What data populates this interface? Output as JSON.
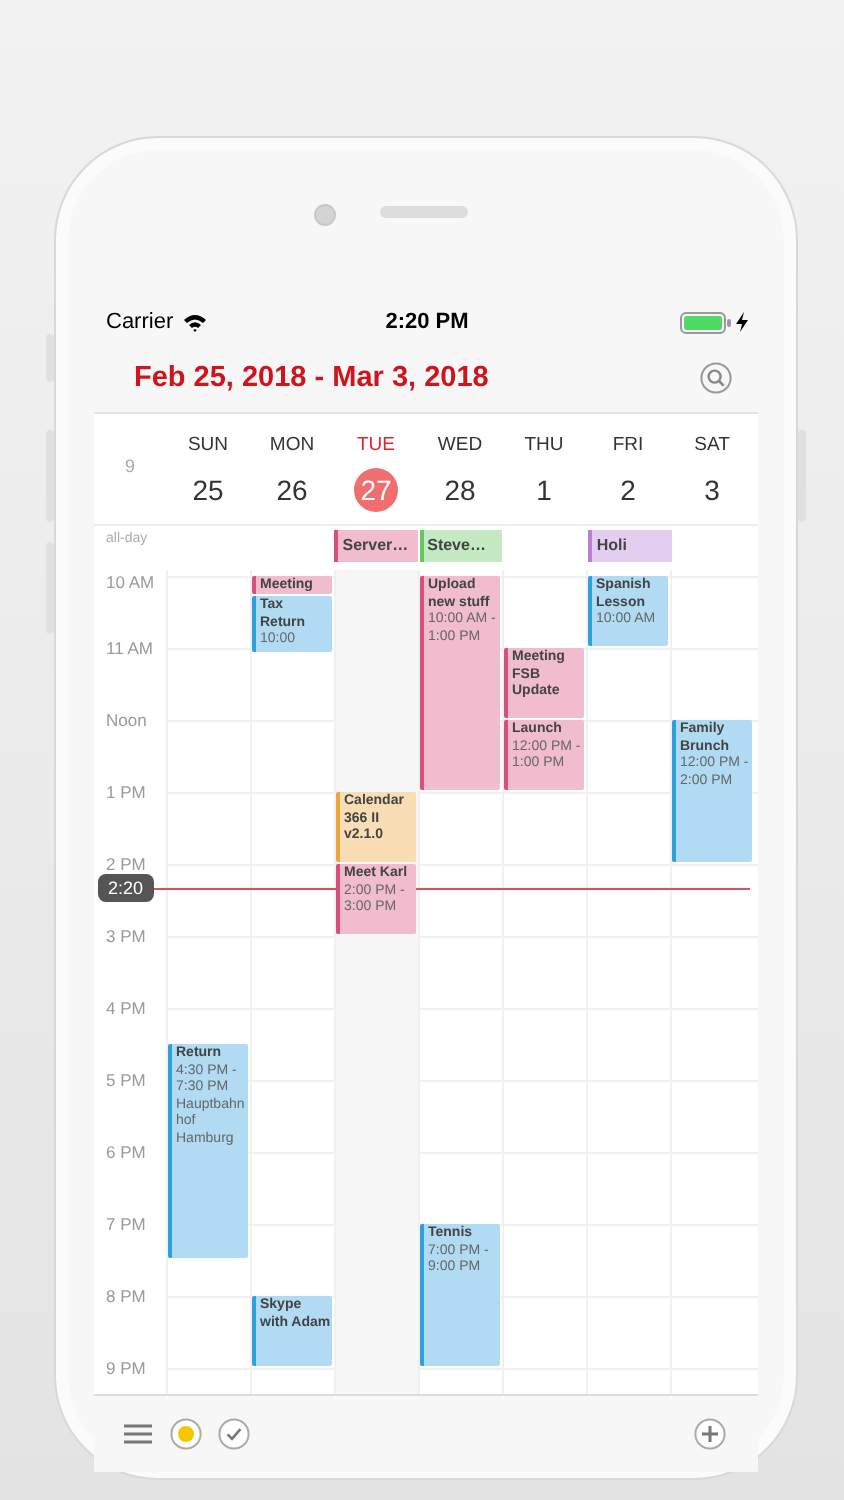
{
  "status_bar": {
    "carrier": "Carrier",
    "time": "2:20 PM"
  },
  "header": {
    "title": "Feb 25, 2018 - Mar 3, 2018"
  },
  "week_number": "9",
  "all_day_label": "all-day",
  "hours": [
    "10 AM",
    "11 AM",
    "Noon",
    "1 PM",
    "2 PM",
    "3 PM",
    "4 PM",
    "5 PM",
    "6 PM",
    "7 PM",
    "8 PM",
    "9 PM"
  ],
  "days": [
    {
      "weekday": "SUN",
      "date": "25",
      "today": false,
      "events": [
        {
          "title": "Return",
          "time": "4:30 PM - 7:30 PM",
          "note": "Hauptbahnhof Hamburg",
          "color": "#2ea1dc"
        }
      ]
    },
    {
      "weekday": "MON",
      "date": "26",
      "today": false,
      "events": [
        {
          "title": "Meeting",
          "color": "#d94f7c"
        },
        {
          "title": "Tax Return",
          "time": "10:00",
          "color": "#2ea1dc"
        },
        {
          "title": "Skype with Adam",
          "color": "#2ea1dc"
        }
      ]
    },
    {
      "weekday": "TUE",
      "date": "27",
      "today": true,
      "all_day": [
        {
          "title": "Server…",
          "color": "#d94f7c"
        }
      ],
      "events": [
        {
          "title": "Calendar 366 II v2.1.0",
          "color": "#f0a53a"
        },
        {
          "title": "Meet Karl",
          "time": "2:00 PM - 3:00 PM",
          "color": "#d94f7c"
        }
      ]
    },
    {
      "weekday": "WED",
      "date": "28",
      "today": false,
      "all_day": [
        {
          "title": "Steve…",
          "color": "#67c45f"
        }
      ],
      "events": [
        {
          "title": "Upload new stuff",
          "time": "10:00 AM - 1:00 PM",
          "color": "#d94f7c"
        },
        {
          "title": "Tennis",
          "time": "7:00 PM - 9:00 PM",
          "color": "#2ea1dc"
        }
      ]
    },
    {
      "weekday": "THU",
      "date": "1",
      "today": false,
      "events": [
        {
          "title": "Meeting FSB Update",
          "color": "#d94f7c"
        },
        {
          "title": "Launch",
          "time": "12:00 PM - 1:00 PM",
          "color": "#d94f7c"
        }
      ]
    },
    {
      "weekday": "FRI",
      "date": "2",
      "today": false,
      "all_day": [
        {
          "title": "Holi",
          "color": "#b97fd6"
        }
      ],
      "events": [
        {
          "title": "Spanish Lesson",
          "time": "10:00 AM",
          "color": "#2ea1dc"
        }
      ]
    },
    {
      "weekday": "SAT",
      "date": "3",
      "today": false,
      "events": [
        {
          "title": "Family Brunch",
          "time": "12:00 PM - 2:00 PM",
          "color": "#2ea1dc"
        }
      ]
    }
  ],
  "now": {
    "label": "2:20"
  }
}
